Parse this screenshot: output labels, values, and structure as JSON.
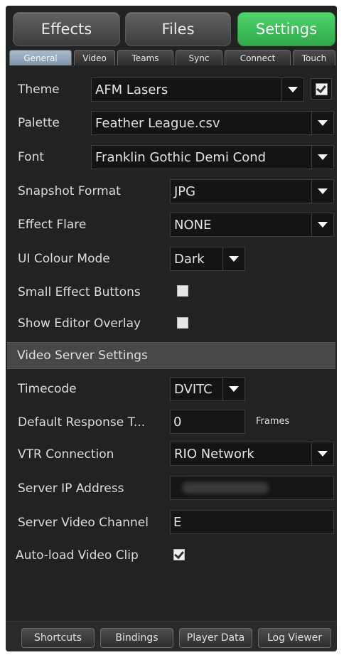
{
  "top_tabs": {
    "effects": "Effects",
    "files": "Files",
    "settings": "Settings"
  },
  "sub_tabs": {
    "general": "General",
    "video": "Video",
    "teams": "Teams",
    "sync": "Sync",
    "connect": "Connect",
    "touch": "Touch"
  },
  "general": {
    "theme_label": "Theme",
    "theme_value": "AFM Lasers",
    "theme_checked": true,
    "palette_label": "Palette",
    "palette_value": "Feather League.csv",
    "font_label": "Font",
    "font_value": "Franklin Gothic Demi Cond",
    "snapshot_label": "Snapshot Format",
    "snapshot_value": "JPG",
    "flare_label": "Effect Flare",
    "flare_value": "NONE",
    "ui_colour_label": "UI Colour Mode",
    "ui_colour_value": "Dark",
    "small_buttons_label": "Small Effect Buttons",
    "small_buttons_checked": false,
    "editor_overlay_label": "Show Editor Overlay",
    "editor_overlay_checked": false
  },
  "video_server": {
    "section_title": "Video Server Settings",
    "timecode_label": "Timecode",
    "timecode_value": "DVITC",
    "response_label": "Default Response T...",
    "response_value": "0",
    "response_unit": "Frames",
    "vtr_label": "VTR Connection",
    "vtr_value": "RIO Network",
    "ip_label": "Server IP Address",
    "channel_label": "Server Video Channel",
    "channel_value": "E",
    "autoload_label": "Auto-load Video Clip",
    "autoload_checked": true
  },
  "bottom_bar": {
    "shortcuts": "Shortcuts",
    "bindings": "Bindings",
    "player_data": "Player Data",
    "log_viewer": "Log Viewer"
  },
  "colors": {
    "accent_active_tab": "#3dbf58",
    "panel_background": "#222222",
    "section_header": "#484848",
    "subtab_active": "#8fa5b6"
  }
}
